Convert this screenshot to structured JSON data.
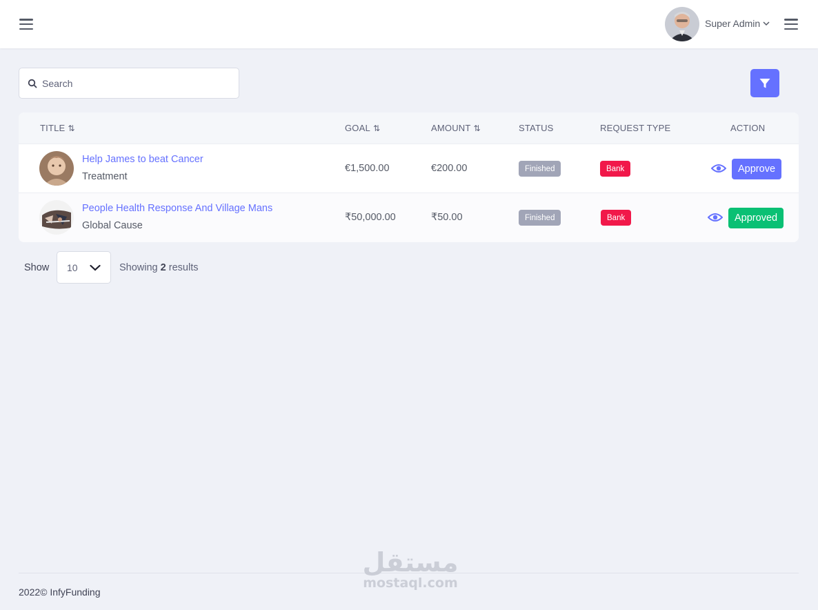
{
  "header": {
    "user_name": "Super Admin"
  },
  "search": {
    "placeholder": "Search"
  },
  "table": {
    "columns": {
      "title": "TITLE",
      "goal": "GOAL",
      "amount": "AMOUNT",
      "status": "STATUS",
      "request_type": "REQUEST TYPE",
      "action": "ACTION"
    },
    "sort_glyph": "⇅",
    "rows": [
      {
        "title": "Help James to beat Cancer",
        "category": "Treatment",
        "goal": "€1,500.00",
        "amount": "€200.00",
        "status": "Finished",
        "request_type": "Bank",
        "action_label": "Approve"
      },
      {
        "title": "People Health Response And Village Mans",
        "category": "Global Cause",
        "goal": "₹50,000.00",
        "amount": "₹50.00",
        "status": "Finished",
        "request_type": "Bank",
        "action_label": "Approved"
      }
    ]
  },
  "pagination": {
    "show_label": "Show",
    "per_page": "10",
    "showing_prefix": "Showing",
    "count": "2",
    "showing_suffix": "results"
  },
  "footer": {
    "copyright": "2022© InfyFunding"
  },
  "watermark": {
    "arabic": "مستقل",
    "latin": "mostaql.com"
  },
  "colors": {
    "primary": "#6571ff",
    "success": "#0ac074",
    "danger": "#f1184a",
    "muted_badge": "#a1a5b7",
    "background": "#eff1f7"
  },
  "icons": {
    "menu": "hamburger-icon",
    "search": "search-icon",
    "filter": "filter-icon",
    "view": "eye-icon",
    "dropdown": "chevron-down-icon"
  }
}
